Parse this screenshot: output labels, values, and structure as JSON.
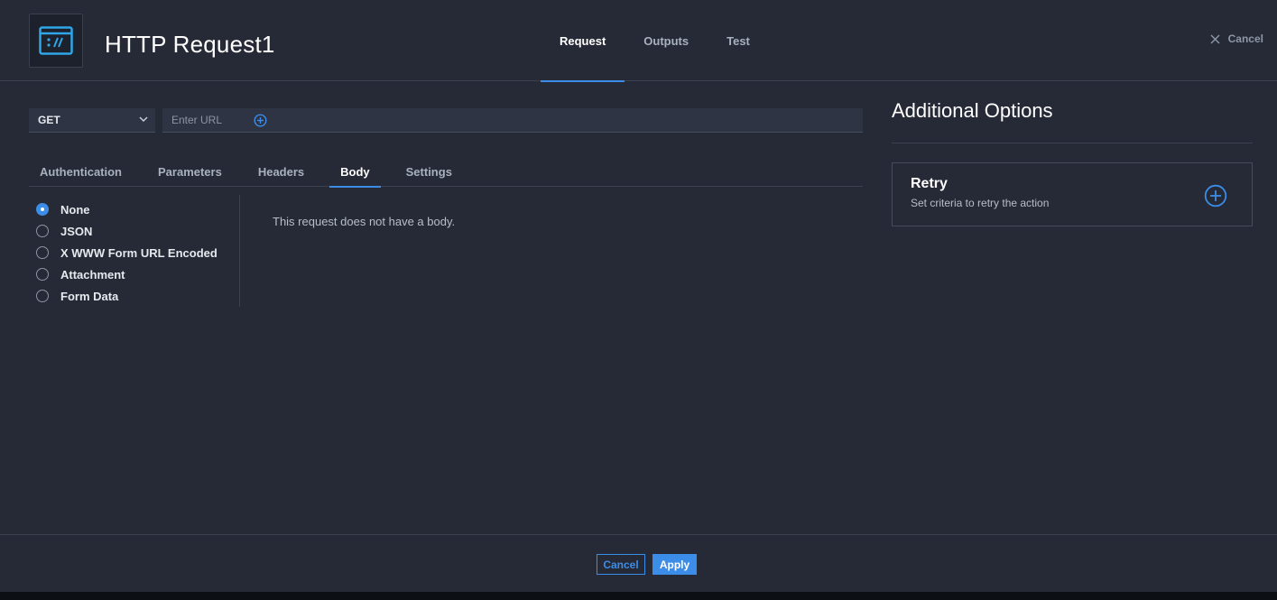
{
  "header": {
    "title": "HTTP Request1",
    "icon": "http-request-icon",
    "tabs": [
      {
        "label": "Request",
        "active": true
      },
      {
        "label": "Outputs",
        "active": false
      },
      {
        "label": "Test",
        "active": false
      }
    ],
    "cancel_label": "Cancel"
  },
  "request": {
    "method": "GET",
    "url_value": "",
    "url_placeholder": "Enter URL",
    "subtabs": [
      {
        "label": "Authentication",
        "active": false
      },
      {
        "label": "Parameters",
        "active": false
      },
      {
        "label": "Headers",
        "active": false
      },
      {
        "label": "Body",
        "active": true
      },
      {
        "label": "Settings",
        "active": false
      }
    ],
    "body_options": [
      {
        "label": "None",
        "checked": true
      },
      {
        "label": "JSON",
        "checked": false
      },
      {
        "label": "X WWW Form URL Encoded",
        "checked": false
      },
      {
        "label": "Attachment",
        "checked": false
      },
      {
        "label": "Form Data",
        "checked": false
      }
    ],
    "body_message": "This request does not have a body."
  },
  "additional_options": {
    "title": "Additional Options",
    "retry": {
      "title": "Retry",
      "description": "Set criteria to retry the action"
    }
  },
  "footer": {
    "cancel_label": "Cancel",
    "apply_label": "Apply"
  },
  "colors": {
    "accent": "#3c8de8",
    "background": "#252a36",
    "text": "#e6e9ee"
  }
}
